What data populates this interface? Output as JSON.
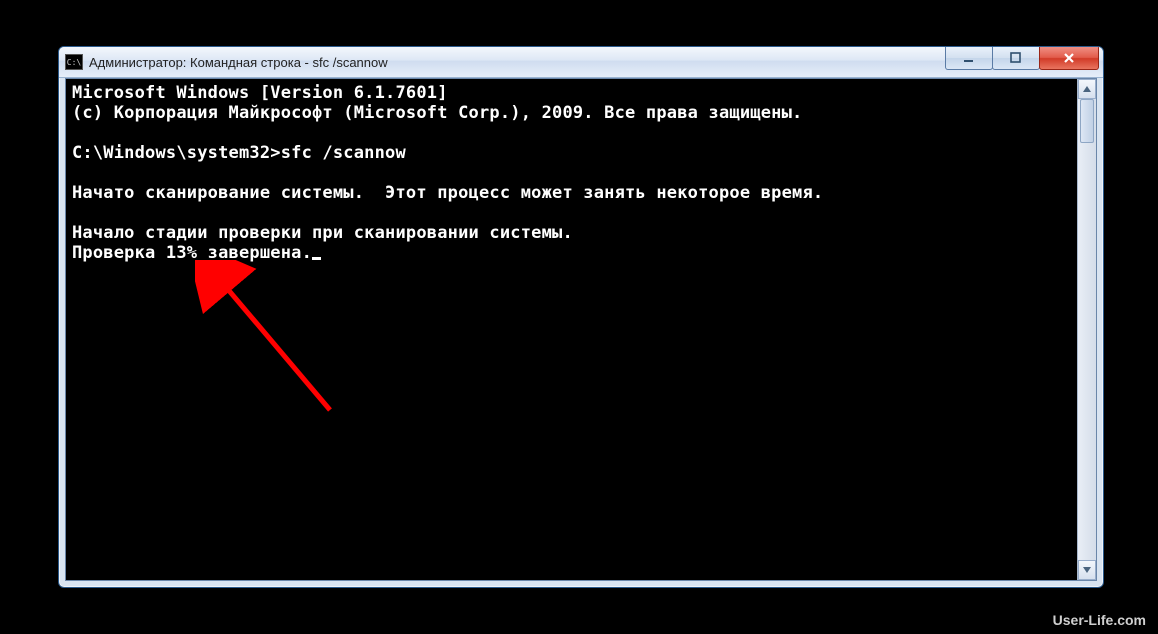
{
  "window": {
    "title": "Администратор: Командная строка - sfc  /scannow",
    "icon_label": "C:\\"
  },
  "controls": {
    "minimize": "minimize",
    "maximize": "maximize",
    "close": "close"
  },
  "console": {
    "line1": "Microsoft Windows [Version 6.1.7601]",
    "line2": "(c) Корпорация Майкрософт (Microsoft Corp.), 2009. Все права защищены.",
    "blank1": "",
    "prompt": "C:\\Windows\\system32>sfc /scannow",
    "blank2": "",
    "line3": "Начато сканирование системы.  Этот процесс может занять некоторое время.",
    "blank3": "",
    "line4": "Начало стадии проверки при сканировании системы.",
    "line5": "Проверка 13% завершена."
  },
  "watermark": "User-Life.com"
}
